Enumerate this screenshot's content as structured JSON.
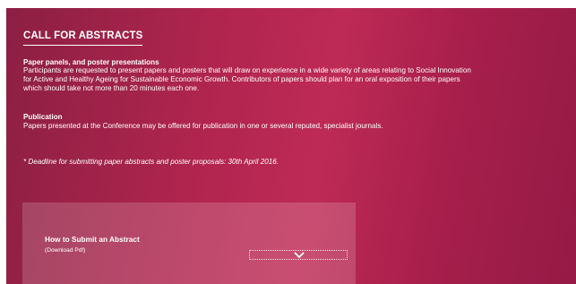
{
  "section": {
    "title": "CALL FOR ABSTRACTS"
  },
  "papers": {
    "heading": "Paper panels, and poster presentations",
    "lines": [
      "Participants are requested to present papers and posters that will draw on experience in a wide variety of areas relating to Social Innovation",
      "for Active and Healthy Ageing for Sustainable Economic Growth. Contributors of papers should plan for an oral exposition of their papers",
      "which should take not more than 20 minutes each one."
    ]
  },
  "publication": {
    "heading": "Publication",
    "text": "Papers presented at the Conference may be offered for publication in one or several reputed, specialist journals."
  },
  "deadline": "* Deadline for submitting paper abstracts and poster proposals: 30th April 2016.",
  "card": {
    "title": "How to Submit an Abstract",
    "subtitle": "(Download Pdf)",
    "toggle_icon": "chevron-down-icon"
  },
  "colors": {
    "background_dark": "#8c1f43",
    "background_mid": "#be2a56",
    "text": "#ffffff"
  }
}
